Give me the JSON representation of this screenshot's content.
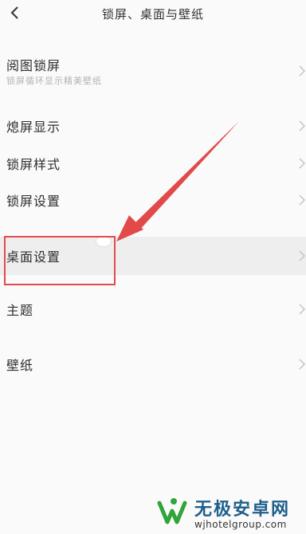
{
  "header": {
    "title": "锁屏、桌面与壁纸",
    "back_icon": "chevron-left-icon"
  },
  "menu": [
    {
      "label": "阅图锁屏",
      "sublabel": "锁屏循环显示精美壁纸"
    },
    {
      "label": "熄屏显示"
    },
    {
      "label": "锁屏样式"
    },
    {
      "label": "锁屏设置"
    },
    {
      "label": "桌面设置",
      "highlighted": true
    },
    {
      "label": "主题"
    },
    {
      "label": "壁纸"
    }
  ],
  "annotation": {
    "box_color": "#e24a4a",
    "arrow_color": "#e24a4a"
  },
  "watermark": {
    "title": "无极安卓网",
    "url": "wjhotelgroup.com"
  }
}
